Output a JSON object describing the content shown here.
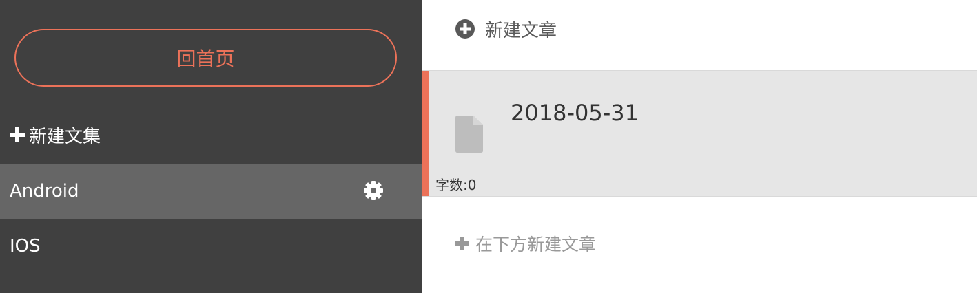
{
  "sidebar": {
    "home_label": "回首页",
    "new_notebook_label": "新建文集",
    "notebooks": [
      {
        "label": "Android",
        "active": true
      },
      {
        "label": "IOS",
        "active": false
      }
    ]
  },
  "main": {
    "new_article_label": "新建文章",
    "articles": [
      {
        "title": "2018-05-31",
        "word_count": "字数:0"
      }
    ],
    "add_below_label": "在下方新建文章"
  },
  "colors": {
    "sidebar_bg": "#404040",
    "active_item_bg": "#666666",
    "accent": "#ec7259",
    "article_bg": "#e6e6e6"
  },
  "icons": {
    "home": "none",
    "new_notebook": "plus-icon",
    "settings": "gear-icon",
    "new_article": "circle-plus-icon",
    "article": "document-icon",
    "add_below": "plus-icon"
  }
}
